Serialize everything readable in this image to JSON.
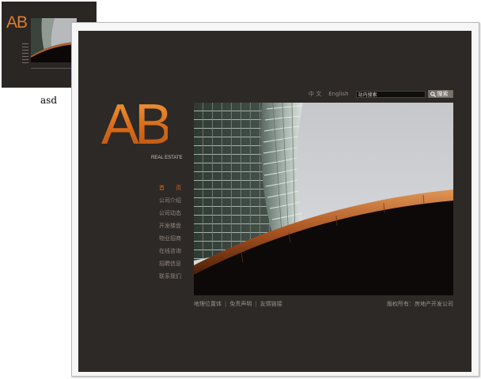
{
  "thumbnail": {
    "logo": "AB",
    "caption": "asd"
  },
  "header": {
    "lang_chinese": "中 文",
    "lang_english": "English",
    "search": {
      "value": "站内搜索",
      "button_label": "搜索",
      "icon": "search-icon"
    }
  },
  "brand": {
    "logo": "AB",
    "subtitle": "REAL ESTATE"
  },
  "nav": {
    "items": [
      {
        "label": "首 页"
      },
      {
        "label": "公司介绍"
      },
      {
        "label": "公司动态"
      },
      {
        "label": "开发楼盘"
      },
      {
        "label": "物业招商"
      },
      {
        "label": "在线咨询"
      },
      {
        "label": "招聘信息"
      },
      {
        "label": "联系我们"
      }
    ]
  },
  "footer": {
    "links": [
      "地理位置体",
      "免责声明",
      "友情链接"
    ],
    "copyright": "版权所有：房地产开发公司"
  },
  "colors": {
    "background": "#2d2926",
    "accent": "#d3671e",
    "nav_text": "#8e857f"
  }
}
